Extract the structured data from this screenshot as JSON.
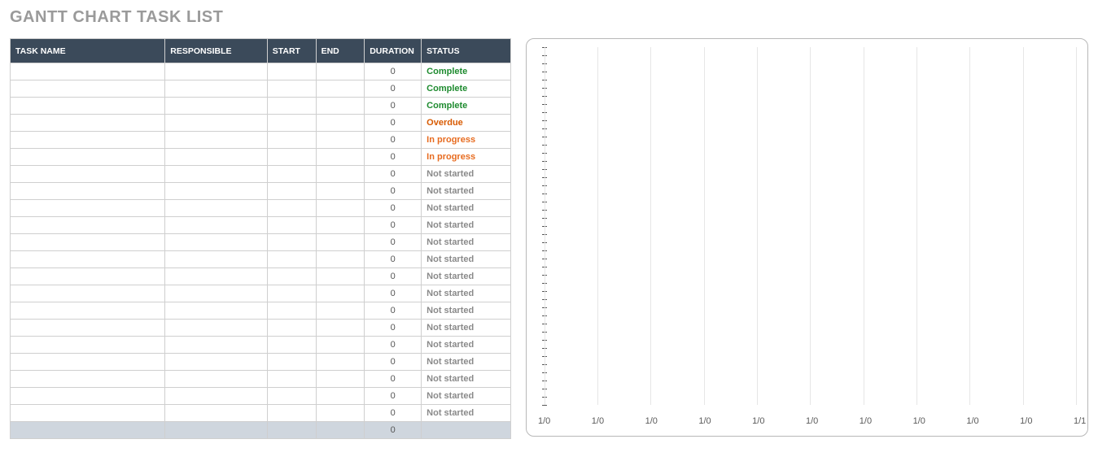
{
  "title": "GANTT CHART TASK LIST",
  "columns": {
    "task": "TASK NAME",
    "responsible": "RESPONSIBLE",
    "start": "START",
    "end": "END",
    "duration": "DURATION",
    "status": "STATUS"
  },
  "status_colors": {
    "Complete": "#1e8b2f",
    "Overdue": "#d85a00",
    "In progress": "#e76b1f",
    "Not started": "#8a8a8a"
  },
  "rows": [
    {
      "task": "",
      "responsible": "",
      "start": "",
      "end": "",
      "duration": "0",
      "status": "Complete"
    },
    {
      "task": "",
      "responsible": "",
      "start": "",
      "end": "",
      "duration": "0",
      "status": "Complete"
    },
    {
      "task": "",
      "responsible": "",
      "start": "",
      "end": "",
      "duration": "0",
      "status": "Complete"
    },
    {
      "task": "",
      "responsible": "",
      "start": "",
      "end": "",
      "duration": "0",
      "status": "Overdue"
    },
    {
      "task": "",
      "responsible": "",
      "start": "",
      "end": "",
      "duration": "0",
      "status": "In progress"
    },
    {
      "task": "",
      "responsible": "",
      "start": "",
      "end": "",
      "duration": "0",
      "status": "In progress"
    },
    {
      "task": "",
      "responsible": "",
      "start": "",
      "end": "",
      "duration": "0",
      "status": "Not started"
    },
    {
      "task": "",
      "responsible": "",
      "start": "",
      "end": "",
      "duration": "0",
      "status": "Not started"
    },
    {
      "task": "",
      "responsible": "",
      "start": "",
      "end": "",
      "duration": "0",
      "status": "Not started"
    },
    {
      "task": "",
      "responsible": "",
      "start": "",
      "end": "",
      "duration": "0",
      "status": "Not started"
    },
    {
      "task": "",
      "responsible": "",
      "start": "",
      "end": "",
      "duration": "0",
      "status": "Not started"
    },
    {
      "task": "",
      "responsible": "",
      "start": "",
      "end": "",
      "duration": "0",
      "status": "Not started"
    },
    {
      "task": "",
      "responsible": "",
      "start": "",
      "end": "",
      "duration": "0",
      "status": "Not started"
    },
    {
      "task": "",
      "responsible": "",
      "start": "",
      "end": "",
      "duration": "0",
      "status": "Not started"
    },
    {
      "task": "",
      "responsible": "",
      "start": "",
      "end": "",
      "duration": "0",
      "status": "Not started"
    },
    {
      "task": "",
      "responsible": "",
      "start": "",
      "end": "",
      "duration": "0",
      "status": "Not started"
    },
    {
      "task": "",
      "responsible": "",
      "start": "",
      "end": "",
      "duration": "0",
      "status": "Not started"
    },
    {
      "task": "",
      "responsible": "",
      "start": "",
      "end": "",
      "duration": "0",
      "status": "Not started"
    },
    {
      "task": "",
      "responsible": "",
      "start": "",
      "end": "",
      "duration": "0",
      "status": "Not started"
    },
    {
      "task": "",
      "responsible": "",
      "start": "",
      "end": "",
      "duration": "0",
      "status": "Not started"
    },
    {
      "task": "",
      "responsible": "",
      "start": "",
      "end": "",
      "duration": "0",
      "status": "Not started"
    }
  ],
  "summary": {
    "duration": "0"
  },
  "chart_data": {
    "type": "bar",
    "y_ticks_count": 45,
    "x_labels": [
      "1/0",
      "1/0",
      "1/0",
      "1/0",
      "1/0",
      "1/0",
      "1/0",
      "1/0",
      "1/0",
      "1/0",
      "1/1"
    ],
    "series": []
  }
}
